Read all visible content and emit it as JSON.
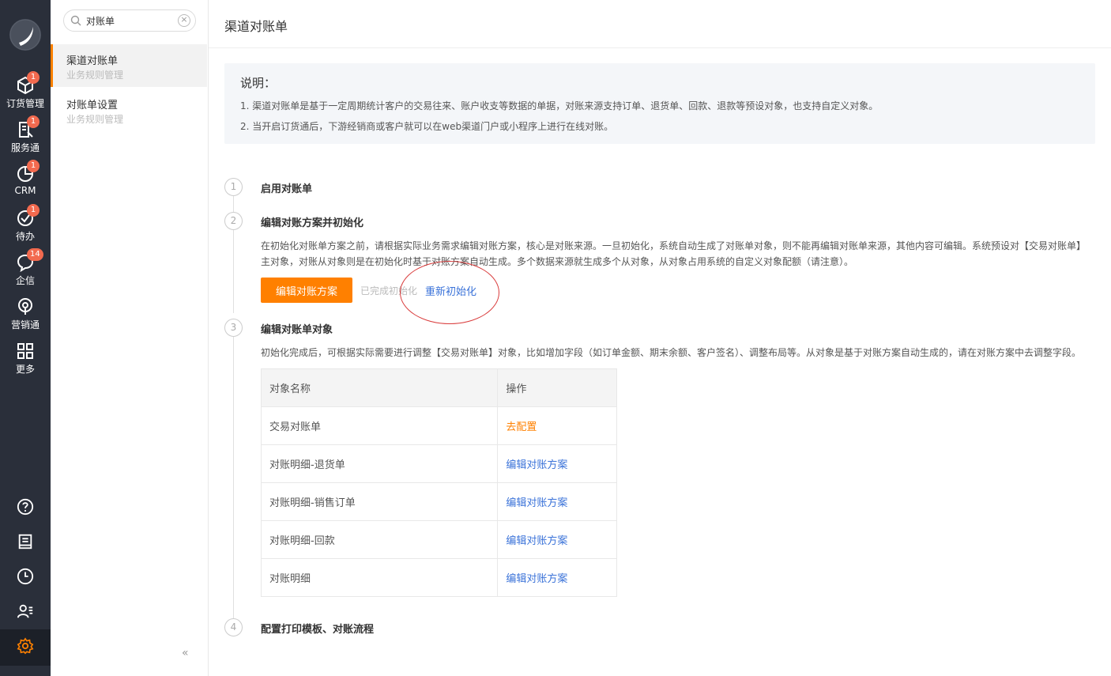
{
  "rail": {
    "items": [
      {
        "label": "订货管理",
        "badge": "1",
        "icon": "cube-icon"
      },
      {
        "label": "服务通",
        "badge": "1",
        "icon": "service-icon"
      },
      {
        "label": "CRM",
        "badge": "1",
        "icon": "pie-icon"
      },
      {
        "label": "待办",
        "badge": "1",
        "icon": "check-circle-icon"
      },
      {
        "label": "企信",
        "badge": "14",
        "icon": "chat-icon"
      },
      {
        "label": "营销通",
        "badge": "",
        "icon": "broadcast-icon"
      },
      {
        "label": "更多",
        "badge": "",
        "icon": "grid-icon"
      }
    ],
    "bottom": [
      "help-icon",
      "notebook-icon",
      "clock-icon",
      "contacts-icon",
      "settings-icon"
    ]
  },
  "subnav": {
    "search_value": "对账单",
    "items": [
      {
        "title": "渠道对账单",
        "subtitle": "业务规则管理"
      },
      {
        "title": "对账单设置",
        "subtitle": "业务规则管理"
      }
    ],
    "collapse": "«"
  },
  "main": {
    "title": "渠道对账单",
    "note": {
      "heading": "说明：",
      "line1": "1. 渠道对账单是基于一定周期统计客户的交易往来、账户收支等数据的单据，对账来源支持订单、退货单、回款、退款等预设对象，也支持自定义对象。",
      "line2": "2. 当开启订货通后，下游经销商或客户就可以在web渠道门户或小程序上进行在线对账。"
    },
    "steps": [
      {
        "num": "1",
        "title": "启用对账单"
      },
      {
        "num": "2",
        "title": "编辑对账方案并初始化",
        "desc": "在初始化对账单方案之前，请根据实际业务需求编辑对账方案，核心是对账来源。一旦初始化，系统自动生成了对账单对象，则不能再编辑对账单来源，其他内容可编辑。系统预设对【交易对账单】主对象，对账从对象则是在初始化时基于对账方案自动生成。多个数据来源就生成多个从对象，从对象占用系统的自定义对象配额（请注意）。",
        "button": "编辑对账方案",
        "done": "已完成初始化",
        "reinit": "重新初始化"
      },
      {
        "num": "3",
        "title": "编辑对账单对象",
        "desc": "初始化完成后，可根据实际需要进行调整【交易对账单】对象，比如增加字段（如订单金额、期末余额、客户签名）、调整布局等。从对象是基于对账方案自动生成的，请在对账方案中去调整字段。"
      },
      {
        "num": "4",
        "title": "配置打印模板、对账流程"
      }
    ],
    "table": {
      "headers": [
        "对象名称",
        "操作"
      ],
      "rows": [
        {
          "name": "交易对账单",
          "action": "去配置"
        },
        {
          "name": "对账明细-退货单",
          "action": "编辑对账方案"
        },
        {
          "name": "对账明细-销售订单",
          "action": "编辑对账方案"
        },
        {
          "name": "对账明细-回款",
          "action": "编辑对账方案"
        },
        {
          "name": "对账明细",
          "action": "编辑对账方案"
        }
      ]
    }
  },
  "colors": {
    "accent": "#ff8000",
    "link": "#3b73d9",
    "rail": "#2a2f3a",
    "badge": "#f26a4f",
    "annotation": "#d93b3b"
  }
}
